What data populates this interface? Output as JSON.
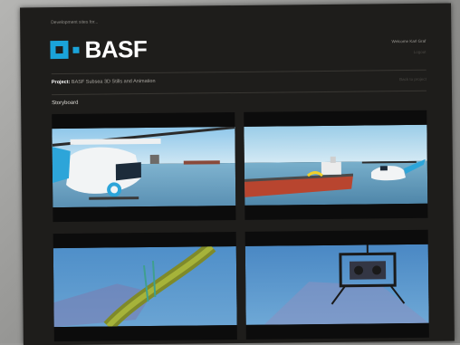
{
  "header": {
    "dev_label": "Development sites for...",
    "brand": "BASF",
    "welcome": "Welcome Karl Graf",
    "logout": "Logout"
  },
  "project": {
    "label": "Project:",
    "name": "BASF Subsea 3D Stills and Animation",
    "right_link": "Back to project"
  },
  "storyboard": {
    "title": "Storyboard",
    "frames": [
      {
        "name": "frame-1",
        "subject": "helicopter close-up over sea"
      },
      {
        "name": "frame-2",
        "subject": "ship with helicopter"
      },
      {
        "name": "frame-3",
        "subject": "underwater pipe"
      },
      {
        "name": "frame-4",
        "subject": "underwater ROV"
      }
    ]
  },
  "colors": {
    "page_bg": "#1e1d1b",
    "brand_blue": "#1aa3d9",
    "text_white": "#ffffff"
  }
}
